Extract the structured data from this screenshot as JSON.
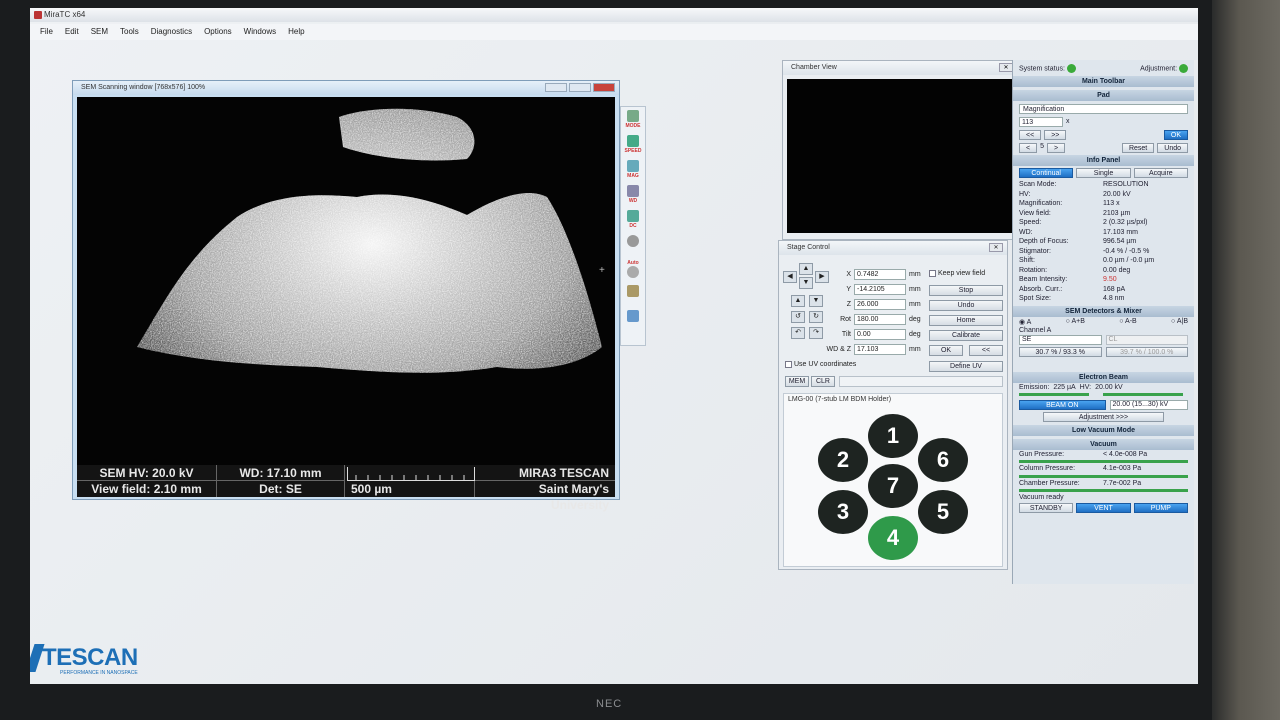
{
  "app": {
    "title": "MiraTC x64"
  },
  "menu": [
    "File",
    "Edit",
    "SEM",
    "Tools",
    "Diagnostics",
    "Options",
    "Windows",
    "Help"
  ],
  "sem_window": {
    "title": "SEM Scanning window [768x576] 100%",
    "status": {
      "hv": "SEM HV: 20.0 kV",
      "wd": "WD: 17.10 mm",
      "brand": "MIRA3 TESCAN",
      "view_field": "View field: 2.10 mm",
      "det": "Det: SE",
      "scale": "500 µm",
      "org": "Saint Mary's University"
    }
  },
  "toolbar": [
    "MODE",
    "SPEED",
    "MAG",
    "WD",
    "DC",
    "",
    "Auto",
    "",
    ""
  ],
  "chamber": {
    "title": "Chamber View"
  },
  "stage": {
    "title": "Stage Control",
    "x": "0.7482",
    "y": "-14.2105",
    "z": "26.000",
    "rot": "180.00",
    "tilt": "0.00",
    "wdz": "17.103",
    "unit_mm": "mm",
    "unit_deg": "deg",
    "labels": {
      "x": "X",
      "y": "Y",
      "z": "Z",
      "rot": "Rot",
      "tilt": "Tilt",
      "wdz": "WD & Z"
    },
    "keep_view": "Keep view field",
    "buttons": {
      "stop": "Stop",
      "undo": "Undo",
      "home": "Home",
      "calibrate": "Calibrate",
      "ok": "OK",
      "back": "<<",
      "define_uv": "Define UV"
    },
    "use_uv": "Use UV coordinates",
    "mem": "MEM",
    "clr": "CLR",
    "holder": "LMG-00 (7-stub LM BDM Holder)",
    "stubs": [
      "1",
      "2",
      "6",
      "7",
      "3",
      "5",
      "4"
    ]
  },
  "right": {
    "system_status": "System status:",
    "adjustment": "Adjustment:",
    "main_toolbar": "Main Toolbar",
    "pad": "Pad",
    "magnification_label": "Magnification",
    "mag_value": "113",
    "mag_unit": "x",
    "pad_step": "5",
    "ok": "OK",
    "reset": "Reset",
    "undo": "Undo",
    "info_panel": "Info Panel",
    "modes": [
      "Continual",
      "Single",
      "Acquire"
    ],
    "info": [
      [
        "Scan Mode:",
        "RESOLUTION"
      ],
      [
        "HV:",
        "20.00 kV"
      ],
      [
        "Magnification:",
        "113 x"
      ],
      [
        "View field:",
        "2103 µm"
      ],
      [
        "Speed:",
        "2 (0.32 µs/pxl)"
      ],
      [
        "WD:",
        "17.103 mm"
      ],
      [
        "Depth of Focus:",
        "996.54 µm"
      ],
      [
        "Stigmator:",
        "-0.4 % / -0.5 %"
      ],
      [
        "Shift:",
        "0.0 µm / -0.0 µm"
      ],
      [
        "Rotation:",
        "0.00 deg"
      ],
      [
        "Beam Intensity:",
        "9.50"
      ],
      [
        "Absorb. Curr.:",
        "168 pA"
      ],
      [
        "Spot Size:",
        "4.8 nm"
      ]
    ],
    "detectors": "SEM Detectors & Mixer",
    "det_modes": [
      "A",
      "A+B",
      "A-B",
      "A|B"
    ],
    "channel": "Channel A",
    "se": "SE",
    "cl": "CL",
    "det_val1": "30.7 % / 93.3 %",
    "det_val2": "39.7 % / 100.0 %",
    "electron_beam": "Electron Beam",
    "emission": "Emission:",
    "emission_val": "225 µA",
    "hv": "HV:",
    "hv_val": "20.00 kV",
    "beam_on": "BEAM ON",
    "hv_select": "20.00 (15...30) kV",
    "adjustment_btn": "Adjustment >>>",
    "low_vacuum": "Low Vacuum Mode",
    "vacuum": "Vacuum",
    "gun": "Gun Pressure:",
    "gun_val": "< 4.0e-008 Pa",
    "column": "Column Pressure:",
    "column_val": "4.1e-003 Pa",
    "chamber_p": "Chamber Pressure:",
    "chamber_val": "7.7e-002 Pa",
    "vacuum_ready": "Vacuum ready",
    "standby": "STANDBY",
    "vent": "VENT",
    "pump": "PUMP"
  },
  "logo": {
    "name": "TESCAN",
    "tagline": "PERFORMANCE IN NANOSPACE"
  },
  "monitor": {
    "brand": "NEC"
  },
  "colors": {
    "accent": "#1d6fb6",
    "green": "#2f9a4a",
    "danger": "#c8433b"
  }
}
